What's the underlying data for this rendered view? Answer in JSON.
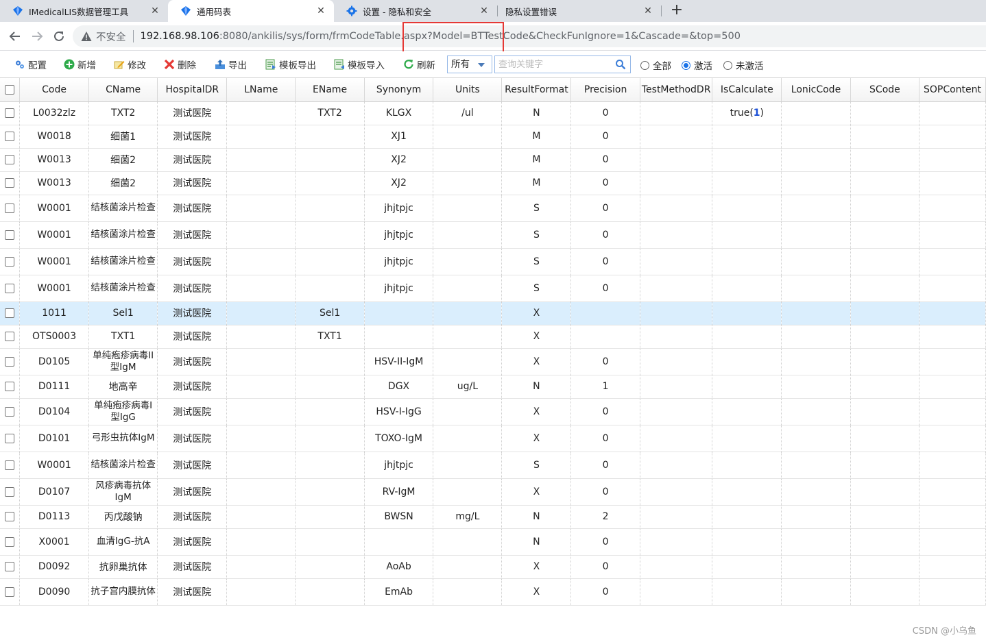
{
  "browser": {
    "tabs": [
      {
        "title": "IMedicalLIS数据管理工具",
        "icon": "gem-icon"
      },
      {
        "title": "通用码表",
        "icon": "gem-icon",
        "active": true
      },
      {
        "title": "设置 - 隐私和安全",
        "icon": "gear-icon"
      },
      {
        "title": "隐私设置错误",
        "icon": ""
      }
    ],
    "new_tab": "+",
    "insecure_label": "不安全",
    "url_host": "192.168.98.106",
    "url_rest": ":8080/ankilis/sys/form/frmCodeTable.aspx?Model=BTTestCode&CheckFunIgnore=1&Cascade=&top=500"
  },
  "toolbar": {
    "config": "配置",
    "add": "新增",
    "edit": "修改",
    "delete": "删除",
    "export": "导出",
    "template_export": "模板导出",
    "template_import": "模板导入",
    "refresh": "刷新",
    "filter_value": "所有",
    "search_placeholder": "查询关键字",
    "radio_all": "全部",
    "radio_active": "激活",
    "radio_inactive": "未激活",
    "radio_selected": "激活"
  },
  "colors": {
    "accent": "#1a73e8",
    "selected_row": "#daeefd",
    "highlight_box": "#e53935"
  },
  "grid": {
    "columns": [
      "Code",
      "CName",
      "HospitalDR",
      "LName",
      "EName",
      "Synonym",
      "Units",
      "ResultFormat",
      "Precision",
      "TestMethodDR",
      "IsCalculate",
      "LonicCode",
      "SCode",
      "SOPContent"
    ],
    "rows": [
      {
        "code": "L0032zlz",
        "cname": "TXT2",
        "hosp": "测试医院",
        "lname": "",
        "ename": "TXT2",
        "syn": "KLGX",
        "units": "/ul",
        "fmt": "N",
        "prec": "0",
        "method": "",
        "calc": "true",
        "calc_num": "1",
        "lonic": "",
        "scode": "",
        "sop": ""
      },
      {
        "code": "W0018",
        "cname": "细菌1",
        "hosp": "测试医院",
        "lname": "",
        "ename": "",
        "syn": "XJ1",
        "units": "",
        "fmt": "M",
        "prec": "0",
        "method": "",
        "calc": "",
        "calc_num": "",
        "lonic": "",
        "scode": "",
        "sop": ""
      },
      {
        "code": "W0013",
        "cname": "细菌2",
        "hosp": "测试医院",
        "lname": "",
        "ename": "",
        "syn": "XJ2",
        "units": "",
        "fmt": "M",
        "prec": "0",
        "method": "",
        "calc": "",
        "calc_num": "",
        "lonic": "",
        "scode": "",
        "sop": ""
      },
      {
        "code": "W0013",
        "cname": "细菌2",
        "hosp": "测试医院",
        "lname": "",
        "ename": "",
        "syn": "XJ2",
        "units": "",
        "fmt": "M",
        "prec": "0",
        "method": "",
        "calc": "",
        "calc_num": "",
        "lonic": "",
        "scode": "",
        "sop": ""
      },
      {
        "code": "W0001",
        "cname": "结核菌涂片检查",
        "hosp": "测试医院",
        "lname": "",
        "ename": "",
        "syn": "jhjtpjc",
        "units": "",
        "fmt": "S",
        "prec": "0",
        "method": "",
        "calc": "",
        "calc_num": "",
        "lonic": "",
        "scode": "",
        "sop": ""
      },
      {
        "code": "W0001",
        "cname": "结核菌涂片检查",
        "hosp": "测试医院",
        "lname": "",
        "ename": "",
        "syn": "jhjtpjc",
        "units": "",
        "fmt": "S",
        "prec": "0",
        "method": "",
        "calc": "",
        "calc_num": "",
        "lonic": "",
        "scode": "",
        "sop": ""
      },
      {
        "code": "W0001",
        "cname": "结核菌涂片检查",
        "hosp": "测试医院",
        "lname": "",
        "ename": "",
        "syn": "jhjtpjc",
        "units": "",
        "fmt": "S",
        "prec": "0",
        "method": "",
        "calc": "",
        "calc_num": "",
        "lonic": "",
        "scode": "",
        "sop": ""
      },
      {
        "code": "W0001",
        "cname": "结核菌涂片检查",
        "hosp": "测试医院",
        "lname": "",
        "ename": "",
        "syn": "jhjtpjc",
        "units": "",
        "fmt": "S",
        "prec": "0",
        "method": "",
        "calc": "",
        "calc_num": "",
        "lonic": "",
        "scode": "",
        "sop": ""
      },
      {
        "code": "1011",
        "cname": "Sel1",
        "hosp": "测试医院",
        "lname": "",
        "ename": "Sel1",
        "syn": "",
        "units": "",
        "fmt": "X",
        "prec": "",
        "method": "",
        "calc": "",
        "calc_num": "",
        "lonic": "",
        "scode": "",
        "sop": "",
        "selected": true
      },
      {
        "code": "OTS0003",
        "cname": "TXT1",
        "hosp": "测试医院",
        "lname": "",
        "ename": "TXT1",
        "syn": "",
        "units": "",
        "fmt": "X",
        "prec": "",
        "method": "",
        "calc": "",
        "calc_num": "",
        "lonic": "",
        "scode": "",
        "sop": ""
      },
      {
        "code": "D0105",
        "cname": "单纯疱疹病毒II型IgM",
        "hosp": "测试医院",
        "lname": "",
        "ename": "",
        "syn": "HSV-II-IgM",
        "units": "",
        "fmt": "X",
        "prec": "0",
        "method": "",
        "calc": "",
        "calc_num": "",
        "lonic": "",
        "scode": "",
        "sop": ""
      },
      {
        "code": "D0111",
        "cname": "地高辛",
        "hosp": "测试医院",
        "lname": "",
        "ename": "",
        "syn": "DGX",
        "units": "ug/L",
        "fmt": "N",
        "prec": "1",
        "method": "",
        "calc": "",
        "calc_num": "",
        "lonic": "",
        "scode": "",
        "sop": ""
      },
      {
        "code": "D0104",
        "cname": "单纯疱疹病毒I型IgG",
        "hosp": "测试医院",
        "lname": "",
        "ename": "",
        "syn": "HSV-I-IgG",
        "units": "",
        "fmt": "X",
        "prec": "0",
        "method": "",
        "calc": "",
        "calc_num": "",
        "lonic": "",
        "scode": "",
        "sop": ""
      },
      {
        "code": "D0101",
        "cname": "弓形虫抗体IgM",
        "hosp": "测试医院",
        "lname": "",
        "ename": "",
        "syn": "TOXO-IgM",
        "units": "",
        "fmt": "X",
        "prec": "0",
        "method": "",
        "calc": "",
        "calc_num": "",
        "lonic": "",
        "scode": "",
        "sop": ""
      },
      {
        "code": "W0001",
        "cname": "结核菌涂片检查",
        "hosp": "测试医院",
        "lname": "",
        "ename": "",
        "syn": "jhjtpjc",
        "units": "",
        "fmt": "S",
        "prec": "0",
        "method": "",
        "calc": "",
        "calc_num": "",
        "lonic": "",
        "scode": "",
        "sop": ""
      },
      {
        "code": "D0107",
        "cname": "风疹病毒抗体IgM",
        "hosp": "测试医院",
        "lname": "",
        "ename": "",
        "syn": "RV-IgM",
        "units": "",
        "fmt": "X",
        "prec": "0",
        "method": "",
        "calc": "",
        "calc_num": "",
        "lonic": "",
        "scode": "",
        "sop": ""
      },
      {
        "code": "D0113",
        "cname": "丙戊酸钠",
        "hosp": "测试医院",
        "lname": "",
        "ename": "",
        "syn": "BWSN",
        "units": "mg/L",
        "fmt": "N",
        "prec": "2",
        "method": "",
        "calc": "",
        "calc_num": "",
        "lonic": "",
        "scode": "",
        "sop": ""
      },
      {
        "code": "X0001",
        "cname": "血清IgG-抗A",
        "hosp": "测试医院",
        "lname": "",
        "ename": "",
        "syn": "",
        "units": "",
        "fmt": "N",
        "prec": "0",
        "method": "",
        "calc": "",
        "calc_num": "",
        "lonic": "",
        "scode": "",
        "sop": ""
      },
      {
        "code": "D0092",
        "cname": "抗卵巢抗体",
        "hosp": "测试医院",
        "lname": "",
        "ename": "",
        "syn": "AoAb",
        "units": "",
        "fmt": "X",
        "prec": "0",
        "method": "",
        "calc": "",
        "calc_num": "",
        "lonic": "",
        "scode": "",
        "sop": ""
      },
      {
        "code": "D0090",
        "cname": "抗子宫内膜抗体",
        "hosp": "测试医院",
        "lname": "",
        "ename": "",
        "syn": "EmAb",
        "units": "",
        "fmt": "X",
        "prec": "0",
        "method": "",
        "calc": "",
        "calc_num": "",
        "lonic": "",
        "scode": "",
        "sop": ""
      }
    ]
  },
  "watermark": "CSDN @小乌鱼"
}
